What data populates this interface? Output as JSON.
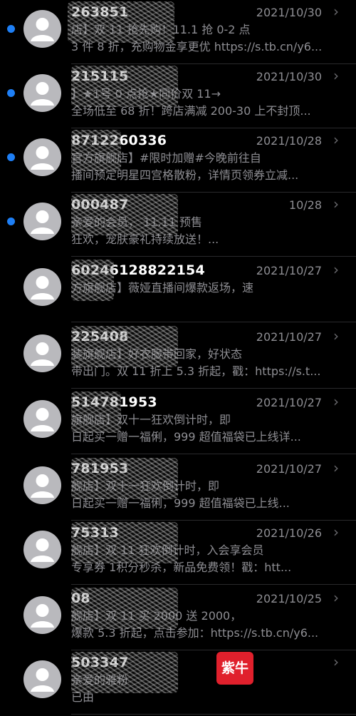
{
  "colors": {
    "background": "#000000",
    "unread": "#1e7ff5",
    "avatar": "#b9b9bd",
    "secondary_text": "#8e8e93"
  },
  "messages": [
    {
      "sender": "263851",
      "date": "2021/10/30",
      "unread": true,
      "line1": "店】双 11 抢先购！11.1 抢 0-2 点",
      "line2": "3 件 8 折，充购物金享更优 https://s.tb.cn/y6..."
    },
    {
      "sender": "215115",
      "date": "2021/10/30",
      "unread": true,
      "line1": "】★1号 0 点抢★同价双 11→",
      "line2": "全场低至 68 折！跨店满减 200-30 上不封顶..."
    },
    {
      "sender": "8712260336",
      "date": "2021/10/28",
      "unread": true,
      "line1": "官方旗舰店】#限时加赠#今晚前往自",
      "line2": "播间预定明星四宫格散粉，详情页领券立减..."
    },
    {
      "sender": "000487",
      "date": "10/28",
      "unread": true,
      "line1": "亲爱的会员，      11.11 预售",
      "line2": "狂欢，宠肤豪礼持续放送！..."
    },
    {
      "sender": "60246128822154",
      "date": "2021/10/27",
      "unread": false,
      "line1": "方旗舰店】薇娅直播间爆款返场，速",
      "line2": ""
    },
    {
      "sender": "225408",
      "date": "2021/10/27",
      "unread": false,
      "line1": "装旗舰店】好衣服带回家，好状态",
      "line2": "带出门。双 11 折上 5.3 折起，戳：https://s.t..."
    },
    {
      "sender": "514781953",
      "date": "2021/10/27",
      "unread": false,
      "line1": "旗舰店】双十一狂欢倒计时，即",
      "line2": "日起买一赠一福俐，999 超值福袋已上线详..."
    },
    {
      "sender": "781953",
      "date": "2021/10/27",
      "unread": false,
      "line1": "舰店】双十一狂欢倒计时，即",
      "line2": "日起买一赠一福俐，999 超值福袋已上线..."
    },
    {
      "sender": "75313",
      "date": "2021/10/26",
      "unread": false,
      "line1": "舰店】双 11 狂欢倒计时，入会享会员",
      "line2": "专享券 1积分秒杀，新品免费领！戳：htt..."
    },
    {
      "sender": "08",
      "date": "2021/10/25",
      "unread": false,
      "line1": "舰店】双 11 买 2000 送 2000，",
      "line2": "爆款 5.3 折起，点击参加：https://s.tb.cn/y6..."
    },
    {
      "sender": "503347",
      "date": "",
      "unread": false,
      "line1": "亲爱的雅粉",
      "line2": "已由"
    }
  ],
  "watermark": "紫牛",
  "chevron": "›"
}
